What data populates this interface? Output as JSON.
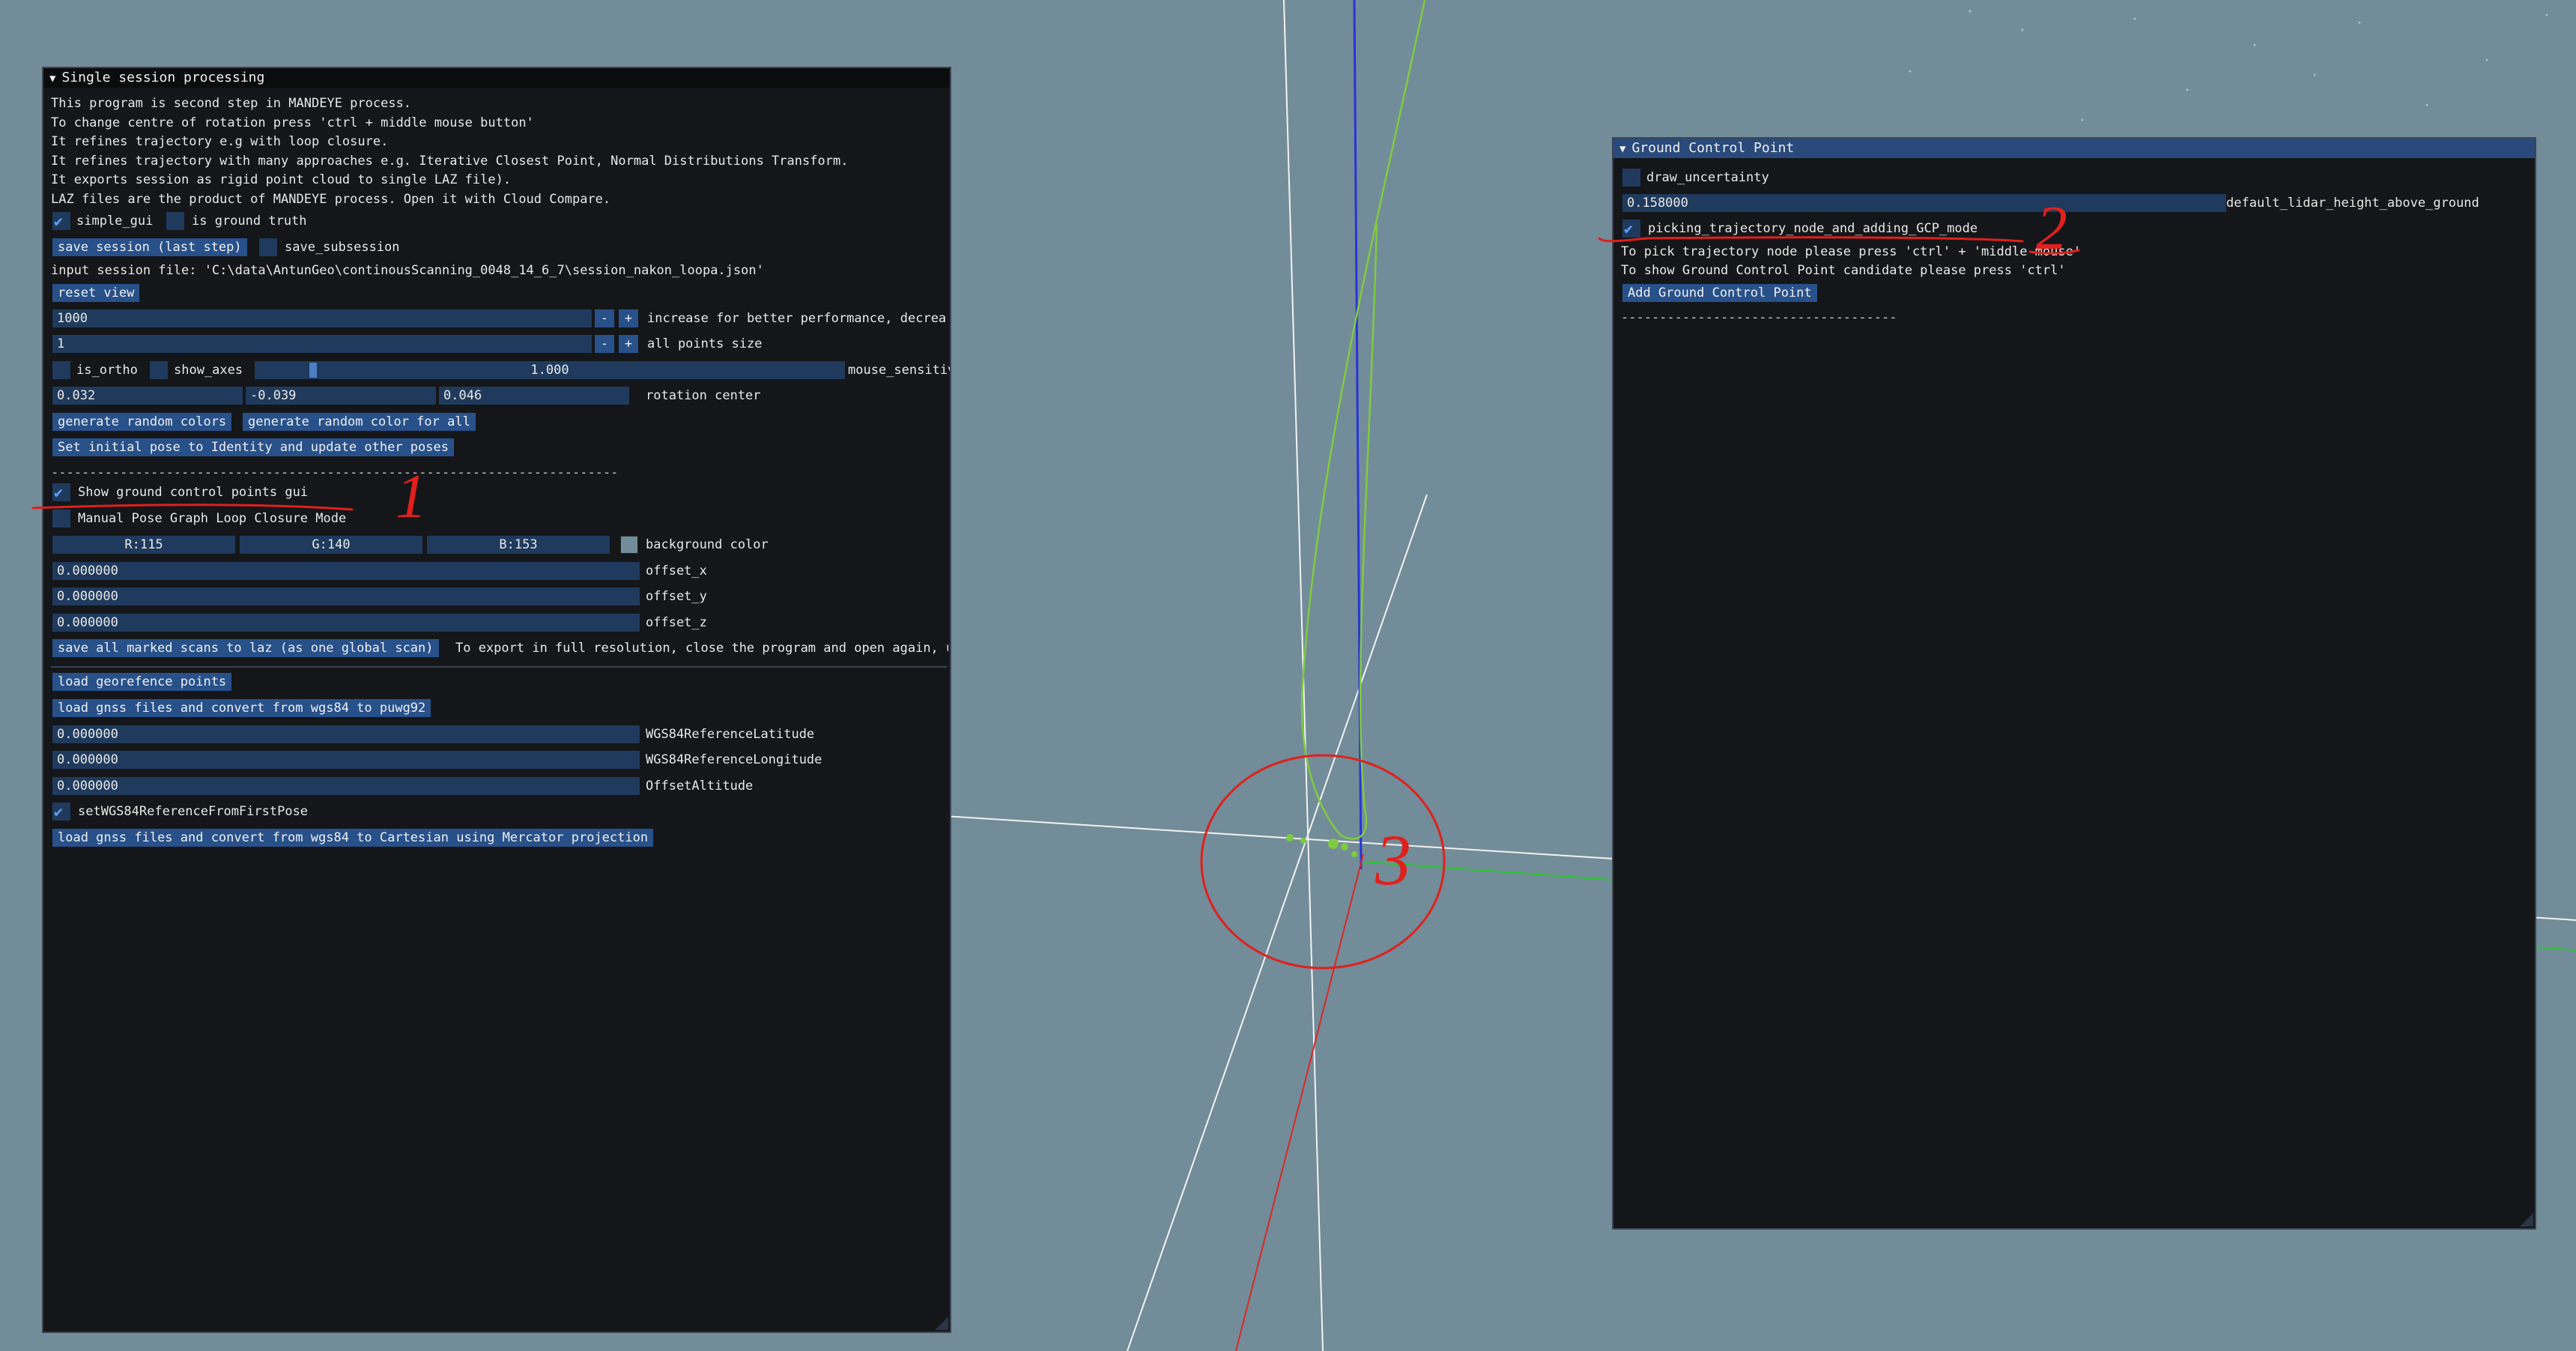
{
  "viewport": {
    "background_color": "#738c99"
  },
  "left_panel": {
    "title": "Single session processing",
    "collapse_icon": "triangle-down-icon",
    "intro_lines": [
      "This program is second step in MANDEYE process.",
      "To change centre of rotation press 'ctrl + middle mouse button'",
      "It refines trajectory e.g with loop closure.",
      "It refines trajectory with many approaches e.g. Iterative Closest Point, Normal Distributions Transform.",
      "It exports session as rigid point cloud to single LAZ file).",
      "LAZ files are the product of MANDEYE process. Open it with Cloud Compare."
    ],
    "simple_gui": {
      "label": "simple_gui",
      "checked": true
    },
    "is_ground_truth": {
      "label": "is ground truth",
      "checked": false
    },
    "save_session_button": "save session (last step)",
    "save_subsession": {
      "label": "save_subsession",
      "checked": false
    },
    "input_session_file": "input session file: 'C:\\data\\AntunGeo\\continousScanning_0048_14_6_7\\session_nakon_loopa.json'",
    "reset_view_button": "reset view",
    "decimation": {
      "value": "1000",
      "minus": "-",
      "plus": "+",
      "label": "increase for better performance, decrease for rendering more points"
    },
    "points_size": {
      "value": "1",
      "minus": "-",
      "plus": "+",
      "label": "all points size"
    },
    "is_ortho": {
      "label": "is_ortho",
      "checked": false
    },
    "show_axes": {
      "label": "show_axes",
      "checked": false
    },
    "mouse_sensitivity": {
      "value": "1.000",
      "fraction": 0.1,
      "label": "mouse_sensitivity"
    },
    "rotation_center": {
      "x": "0.032",
      "y": "-0.039",
      "z": "0.046",
      "label": "rotation center"
    },
    "generate_random_colors_button": "generate random colors",
    "generate_random_color_all_button": "generate random color for all",
    "set_initial_pose_button": "Set initial pose to Identity and update other poses",
    "separator_1": "--------------------------------------------------------------------------",
    "show_gcp_gui": {
      "label": "Show ground control points gui",
      "checked": true
    },
    "manual_pose_graph": {
      "label": "Manual Pose Graph Loop Closure Mode",
      "checked": false
    },
    "background_color": {
      "r": "R:115",
      "g": "G:140",
      "b": "B:153",
      "label": "background color",
      "swatch": "#738c99"
    },
    "offset_x": {
      "value": "0.000000",
      "label": "offset_x"
    },
    "offset_y": {
      "value": "0.000000",
      "label": "offset_y"
    },
    "offset_z": {
      "value": "0.000000",
      "label": "offset_z"
    },
    "save_marked_scans_button": "save all marked scans to laz (as one global scan)",
    "export_hint": "To export in full resolution, close the program and open again, unmark 'simple_gui'",
    "load_georeference_button": "load georefence points",
    "load_gnss_puwg92_button": "load gnss files and convert from wgs84 to puwg92",
    "wgs84_lat": {
      "value": "0.000000",
      "label": "WGS84ReferenceLatitude"
    },
    "wgs84_lon": {
      "value": "0.000000",
      "label": "WGS84ReferenceLongitude"
    },
    "offset_alt": {
      "value": "0.000000",
      "label": "OffsetAltitude"
    },
    "set_wgs84_ref": {
      "label": "setWGS84ReferenceFromFirstPose",
      "checked": true
    },
    "load_gnss_mercator_button": "load gnss files and convert from wgs84 to Cartesian using Mercator projection"
  },
  "gcp_panel": {
    "title": "Ground Control Point",
    "collapse_icon": "triangle-down-icon",
    "draw_uncertainty": {
      "label": "draw_uncertainty",
      "checked": false
    },
    "lidar_height": {
      "value": "0.158000",
      "label": "default_lidar_height_above_ground"
    },
    "picking_mode": {
      "label": "picking_trajectory_node_and_adding_GCP_mode",
      "checked": true
    },
    "hint_1": "To pick trajectory node please press 'ctrl' + 'middle mouse'",
    "hint_2": "To show Ground Control Point candidate please press 'ctrl'",
    "add_gcp_button": "Add Ground Control Point",
    "separator": "------------------------------------"
  },
  "annotations": {
    "color": "#e0201c",
    "mark_1": "1",
    "mark_2": "2",
    "mark_3": "3"
  }
}
